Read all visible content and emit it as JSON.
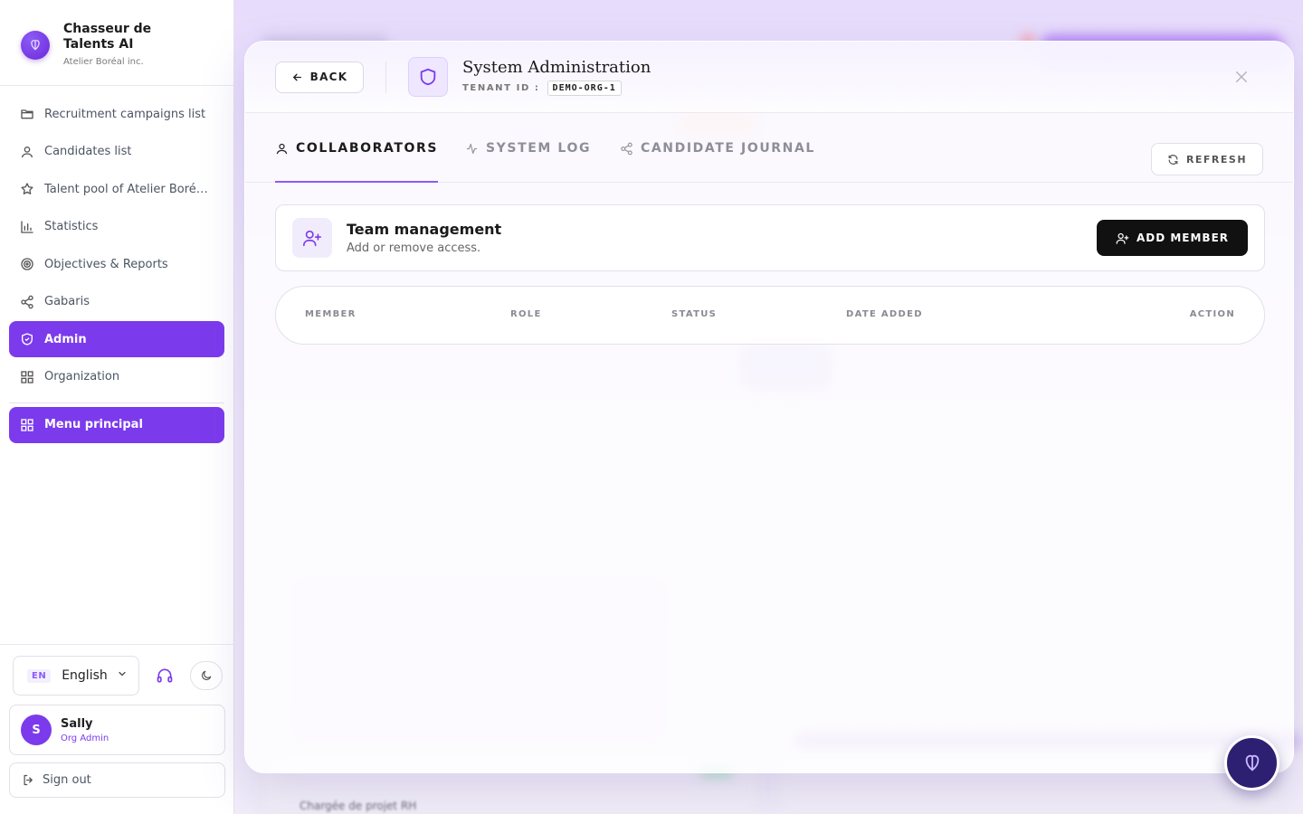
{
  "brand": {
    "name": "Chasseur de Talents AI",
    "org": "Atelier Boréal inc."
  },
  "nav": {
    "items": [
      {
        "label": "Recruitment campaigns list",
        "icon": "folder-icon"
      },
      {
        "label": "Candidates list",
        "icon": "user-icon"
      },
      {
        "label": "Talent pool of Atelier Boréal inc.",
        "icon": "star-icon"
      },
      {
        "label": "Statistics",
        "icon": "bar-chart-icon"
      },
      {
        "label": "Objectives & Reports",
        "icon": "target-icon"
      },
      {
        "label": "Gabaris",
        "icon": "share-icon"
      },
      {
        "label": "Admin",
        "icon": "shield-icon",
        "active": true
      },
      {
        "label": "Organization",
        "icon": "grid-icon"
      }
    ],
    "main_menu": {
      "label": "Menu principal",
      "icon": "grid-icon"
    }
  },
  "language": {
    "code": "EN",
    "label": "English"
  },
  "user": {
    "initial": "S",
    "name": "Sally",
    "role": "Org Admin"
  },
  "signout_label": "Sign out",
  "modal": {
    "back_label": "BACK",
    "title": "System Administration",
    "tenant_label": "TENANT ID :",
    "tenant_value": "DEMO-ORG-1",
    "tabs": [
      {
        "label": "COLLABORATORS",
        "icon": "user-icon",
        "active": true
      },
      {
        "label": "SYSTEM LOG",
        "icon": "activity-icon"
      },
      {
        "label": "CANDIDATE JOURNAL",
        "icon": "share-icon"
      }
    ],
    "refresh_label": "REFRESH",
    "team": {
      "title": "Team management",
      "subtitle": "Add or remove access.",
      "add_label": "ADD MEMBER"
    },
    "table": {
      "columns": [
        "MEMBER",
        "ROLE",
        "STATUS",
        "DATE ADDED",
        "ACTION"
      ],
      "rows": []
    }
  },
  "background": {
    "blurred_text": "Chargée de projet RH"
  },
  "colors": {
    "accent": "#7c3aed",
    "accent_light": "#eee7ff",
    "primary_button": "#111111",
    "fab": "#2d1f72"
  }
}
